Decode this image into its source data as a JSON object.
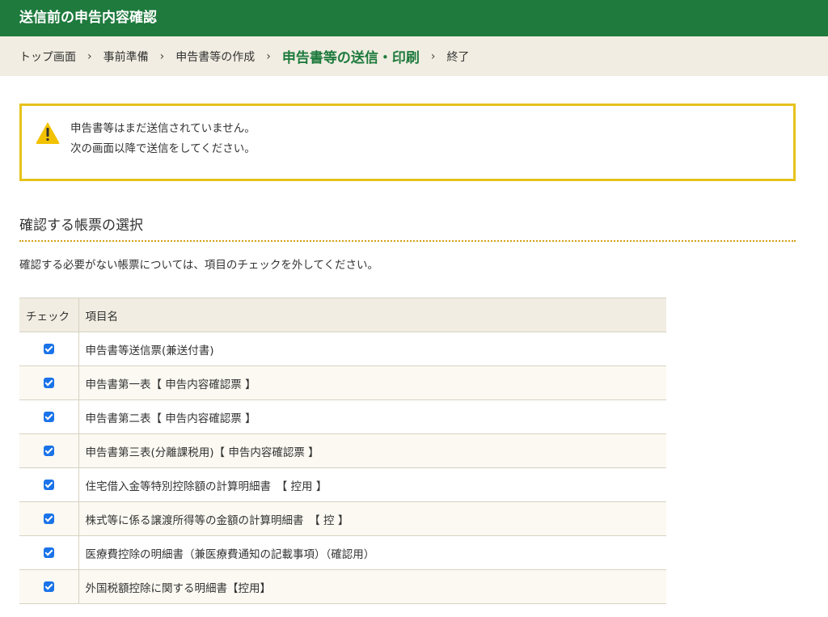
{
  "header": {
    "title": "送信前の申告内容確認"
  },
  "breadcrumb": {
    "items": [
      {
        "label": "トップ画面"
      },
      {
        "label": "事前準備"
      },
      {
        "label": "申告書等の作成"
      },
      {
        "label": "申告書等の送信・印刷"
      },
      {
        "label": "終了"
      }
    ],
    "separator": "›"
  },
  "alert": {
    "line1": "申告書等はまだ送信されていません。",
    "line2": "次の画面以降で送信をしてください。"
  },
  "section": {
    "title": "確認する帳票の選択",
    "description": "確認する必要がない帳票については、項目のチェックを外してください。"
  },
  "table": {
    "headers": {
      "check": "チェック",
      "name": "項目名"
    },
    "rows": [
      {
        "name": "申告書等送信票(兼送付書)",
        "checked": true
      },
      {
        "name": "申告書第一表【 申告内容確認票 】",
        "checked": true
      },
      {
        "name": "申告書第二表【 申告内容確認票 】",
        "checked": true
      },
      {
        "name": "申告書第三表(分離課税用)【 申告内容確認票 】",
        "checked": true
      },
      {
        "name": "住宅借入金等特別控除額の計算明細書　【 控用 】",
        "checked": true
      },
      {
        "name": "株式等に係る譲渡所得等の金額の計算明細書　【 控 】",
        "checked": true
      },
      {
        "name": "医療費控除の明細書（兼医療費通知の記載事項）（確認用）",
        "checked": true
      },
      {
        "name": "外国税額控除に関する明細書【控用】",
        "checked": true
      }
    ]
  },
  "colors": {
    "brand_green": "#1e7a3d",
    "breadcrumb_bg": "#f1ede2",
    "alert_border": "#e6c21b",
    "checkbox": "#1a73e8"
  }
}
